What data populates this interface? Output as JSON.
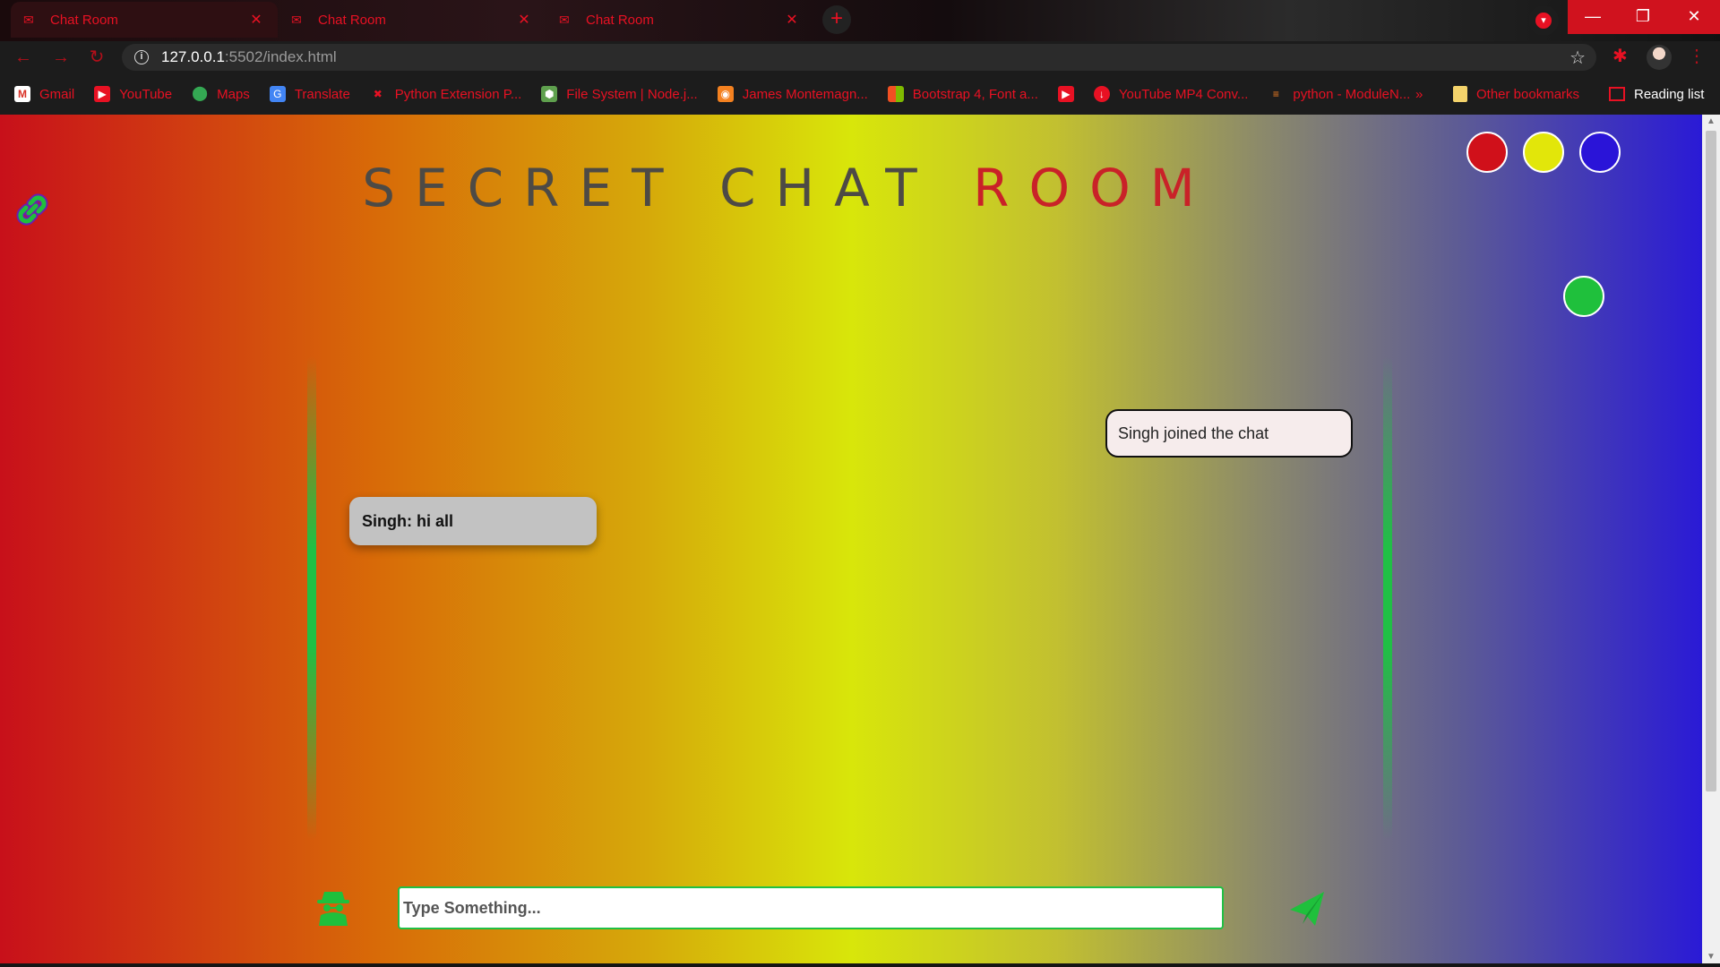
{
  "browser": {
    "tabs": [
      {
        "title": "Chat Room",
        "active": true
      },
      {
        "title": "Chat Room",
        "active": false
      },
      {
        "title": "Chat Room",
        "active": false
      }
    ],
    "new_tab_label": "+",
    "close_label": "✕",
    "url_host": "127.0.0.1",
    "url_path": ":5502/index.html",
    "window_controls": {
      "minimize": "—",
      "restore": "❐",
      "close": "✕"
    },
    "accent_color": "#e81123",
    "bookmarks": [
      {
        "label": "Gmail",
        "icon": "gmail-icon"
      },
      {
        "label": "YouTube",
        "icon": "youtube-icon"
      },
      {
        "label": "Maps",
        "icon": "maps-icon"
      },
      {
        "label": "Translate",
        "icon": "translate-icon"
      },
      {
        "label": "Python Extension P...",
        "icon": "python-extension-icon"
      },
      {
        "label": "File System | Node.j...",
        "icon": "nodejs-icon"
      },
      {
        "label": "James Montemagn...",
        "icon": "blog-icon"
      },
      {
        "label": "Bootstrap 4, Font a...",
        "icon": "microsoft-icon"
      },
      {
        "label": "",
        "icon": "youtube-icon"
      },
      {
        "label": "YouTube MP4 Conv...",
        "icon": "download-icon"
      },
      {
        "label": "python - ModuleN...",
        "icon": "stackoverflow-icon"
      }
    ],
    "bookmarks_overflow": "»",
    "other_bookmarks": "Other bookmarks",
    "reading_list": "Reading list"
  },
  "page": {
    "title_part1": "SECRET CHAT ",
    "title_accent": "ROOM",
    "theme_colors": [
      "#d0101a",
      "#e2e60a",
      "#2a14d8"
    ],
    "status_dot_color": "#1fc03c",
    "divider_color": "#20c045",
    "messages": {
      "system": "Singh joined the chat",
      "user": "Singh: hi all"
    },
    "input": {
      "placeholder": "Type Something..."
    }
  }
}
